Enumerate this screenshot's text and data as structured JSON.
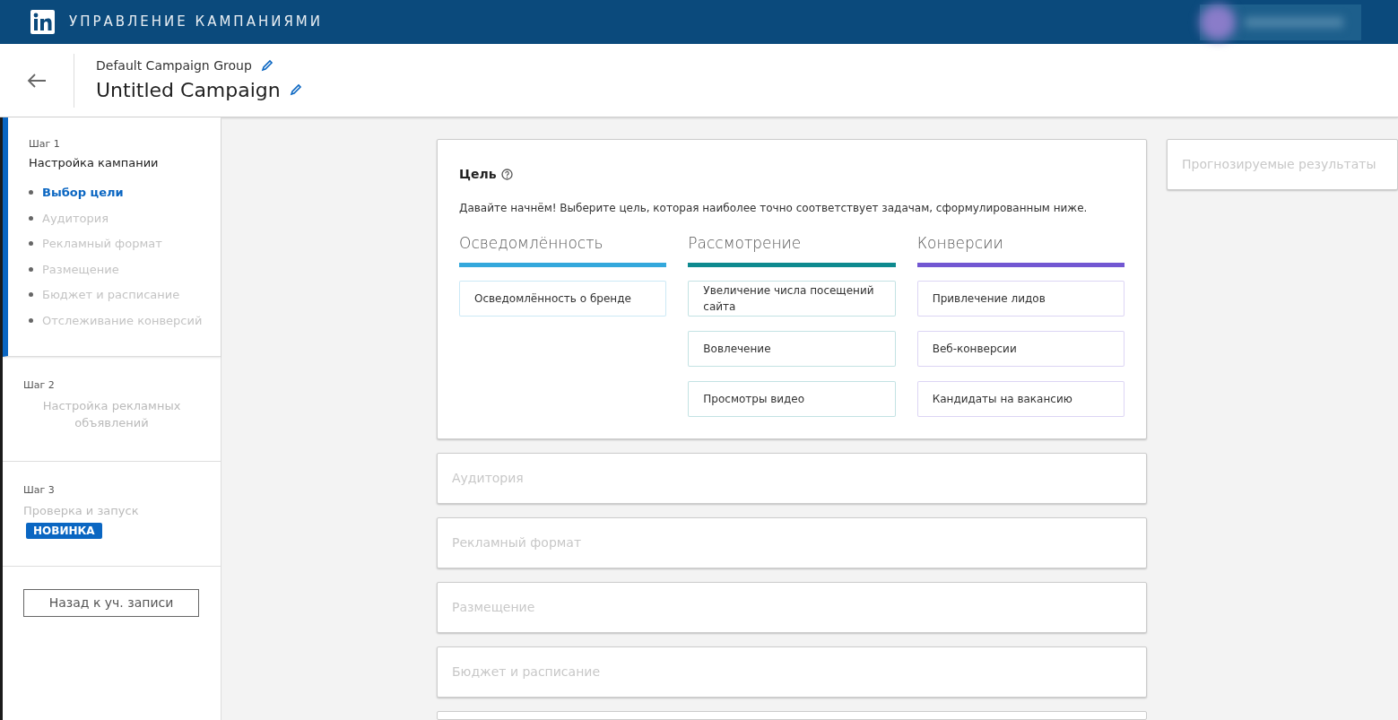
{
  "header": {
    "title": "УПРАВЛЕНИЕ КАМПАНИЯМИ"
  },
  "campaign": {
    "group": "Default Campaign Group",
    "name": "Untitled Campaign"
  },
  "steps": [
    {
      "step": "Шаг 1",
      "title": "Настройка кампании",
      "active": true,
      "substeps": [
        {
          "label": "Выбор цели",
          "selected": true
        },
        {
          "label": "Аудитория",
          "selected": false
        },
        {
          "label": "Рекламный формат",
          "selected": false
        },
        {
          "label": "Размещение",
          "selected": false
        },
        {
          "label": "Бюджет и расписание",
          "selected": false
        },
        {
          "label": "Отслеживание конверсий",
          "selected": false
        }
      ]
    },
    {
      "step": "Шаг 2",
      "title": "Настройка рекламных объявлений",
      "active": false
    },
    {
      "step": "Шаг 3",
      "title": "Проверка и запуск",
      "active": false,
      "badge": "НОВИНКА"
    }
  ],
  "back_button": "Назад к уч. записи",
  "objective": {
    "title": "Цель",
    "intro": "Давайте начнём! Выберите цель, которая наиболее точно соответствует задачам, сформулированным ниже.",
    "groups": [
      {
        "title": "Осведомлённость",
        "color": "#34a8dc",
        "options": [
          "Осведомлённость о бренде"
        ]
      },
      {
        "title": "Рассмотрение",
        "color": "#0e8a8f",
        "options": [
          "Увеличение числа посещений сайта",
          "Вовлечение",
          "Просмотры видео"
        ]
      },
      {
        "title": "Конверсии",
        "color": "#7257d2",
        "options": [
          "Привлечение лидов",
          "Веб-конверсии",
          "Кандидаты на вакансию"
        ]
      }
    ]
  },
  "sections": [
    {
      "title": "Аудитория"
    },
    {
      "title": "Рекламный формат"
    },
    {
      "title": "Размещение"
    },
    {
      "title": "Бюджет и расписание"
    }
  ],
  "forecast": {
    "title": "Прогнозируемые результаты"
  }
}
